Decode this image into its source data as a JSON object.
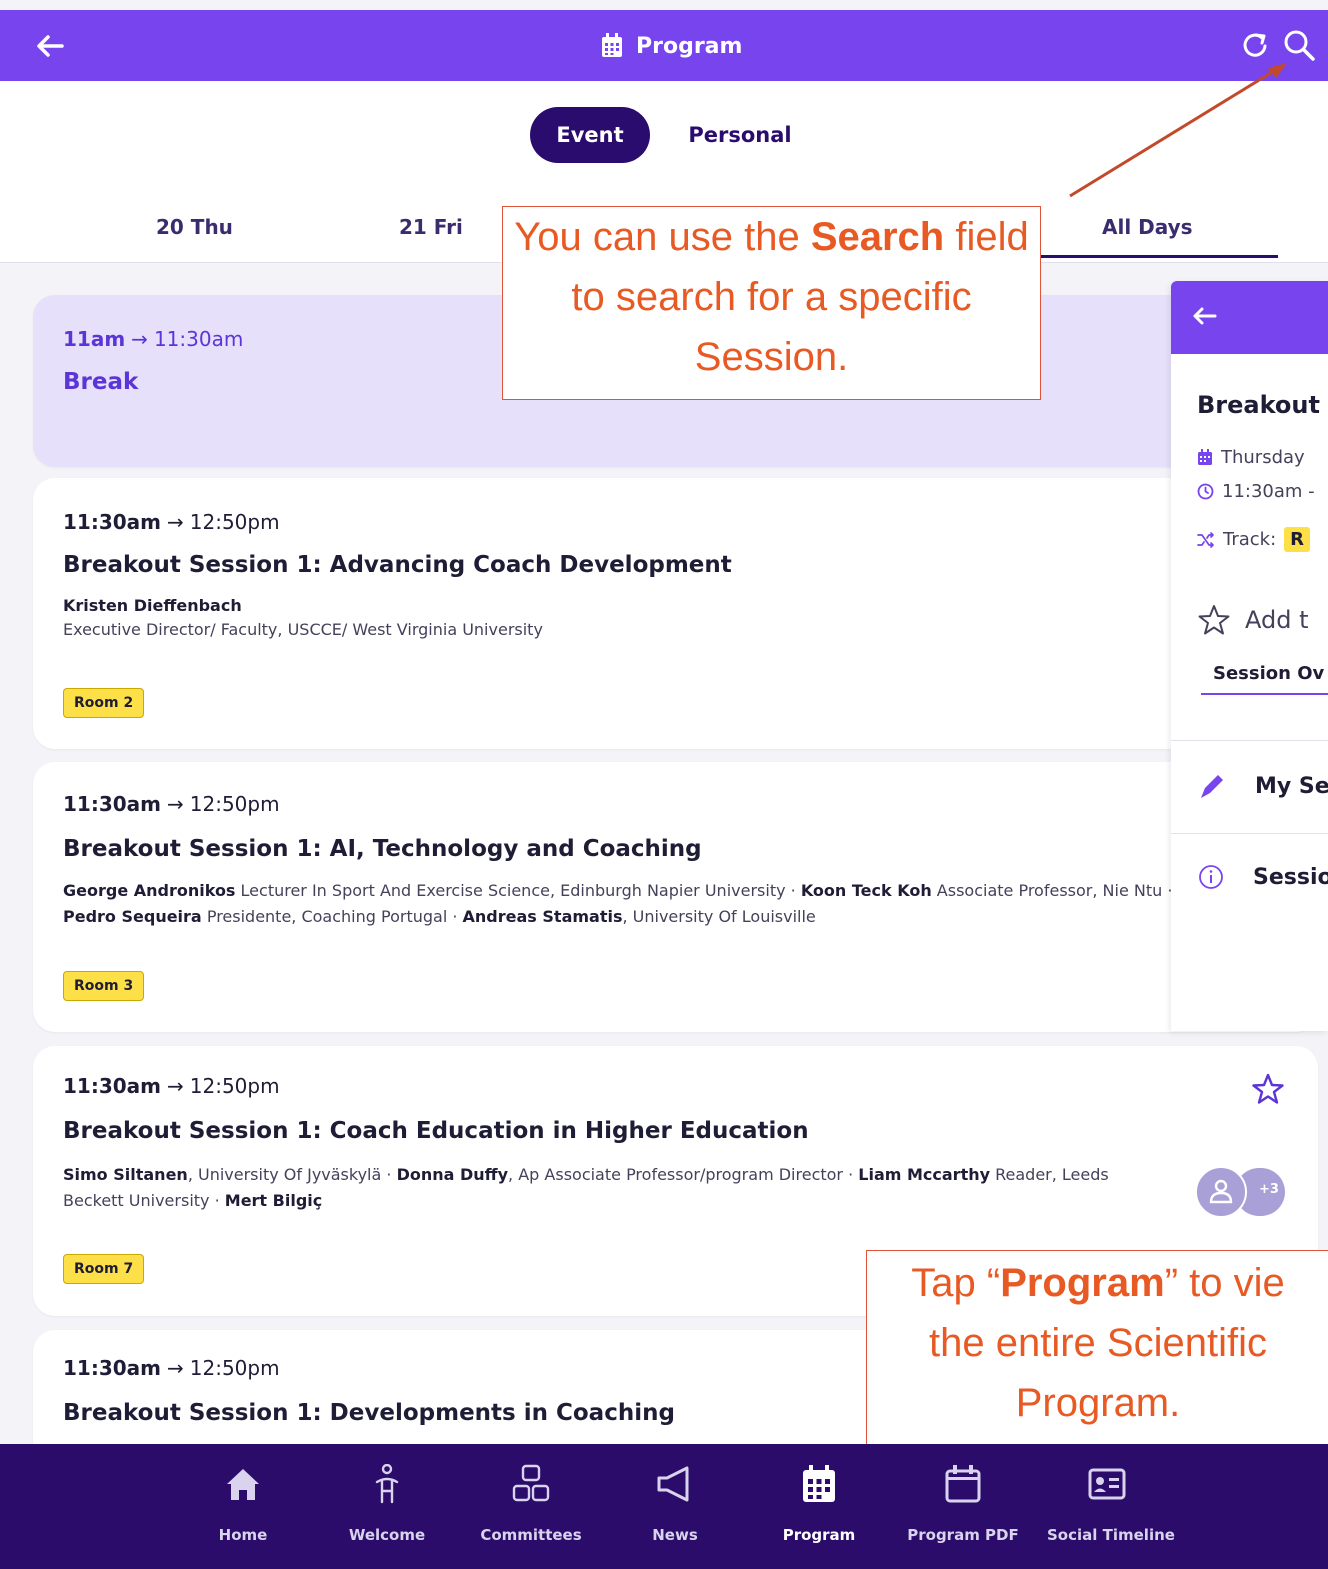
{
  "header": {
    "title": "Program"
  },
  "segments": {
    "event": "Event",
    "personal": "Personal"
  },
  "days": [
    "20 Thu",
    "21 Fri",
    "All Days"
  ],
  "sessions": [
    {
      "start": "11am",
      "end": "11:30am",
      "title": "Break",
      "speakers": []
    },
    {
      "start": "11:30am",
      "end": "12:50pm",
      "title": "Breakout Session 1: Advancing Coach Development",
      "speaker_name": "Kristen Dieffenbach",
      "speaker_role": "Executive Director/ Faculty, USCCE/ West Virginia University",
      "room": "Room 2"
    },
    {
      "start": "11:30am",
      "end": "12:50pm",
      "title": "Breakout Session 1: AI, Technology and Coaching",
      "s1_name": "George Andronikos",
      "s1_role": " Lecturer In Sport And Exercise Science, Edinburgh Napier University · ",
      "s2_name": "Koon Teck Koh",
      "s2_role": " Associate Professor, Nie Ntu · ",
      "s3_name": "Pedro Sequeira",
      "s3_role": " Presidente, Coaching Portugal · ",
      "s4_name": "Andreas Stamatis",
      "s4_role": ", University Of Louisville",
      "room": "Room 3"
    },
    {
      "start": "11:30am",
      "end": "12:50pm",
      "title": "Breakout Session 1: Coach Education in Higher Education",
      "s1_name": "Simo Siltanen",
      "s1_role": ", University Of Jyväskylä · ",
      "s2_name": "Donna Duffy",
      "s2_role": ", Ap Associate Professor/program Director · ",
      "s3_name": "Liam Mccarthy",
      "s3_role": " Reader, Leeds Beckett University · ",
      "s4_name": "Mert Bilgiç",
      "room": "Room 7",
      "avatar_more": "+3"
    },
    {
      "start": "11:30am",
      "end": "12:50pm",
      "title": "Breakout Session 1: Developments in Coaching"
    }
  ],
  "detail": {
    "title": "Breakout",
    "date": "Thursday",
    "time": "11:30am -",
    "track_label": "Track:",
    "track_chip": "R",
    "favorite": "Add t",
    "tab": "Session Ov",
    "item1": "My Se",
    "item2": "Sessio"
  },
  "callouts": {
    "search_pre": "You can use the ",
    "search_bold": "Search",
    "search_post": " field to search for a specific Session.",
    "program_pre": "Tap “",
    "program_bold": "Program",
    "program_post": "” to view the entire Scientific Program."
  },
  "nav": [
    "Home",
    "Welcome",
    "Committees",
    "News",
    "Program",
    "Program PDF",
    "Social Timeline"
  ],
  "colors": {
    "brand": "#7744ee",
    "nav": "#2b0c6a",
    "accent": "#e85a24",
    "chip": "#fde047"
  }
}
